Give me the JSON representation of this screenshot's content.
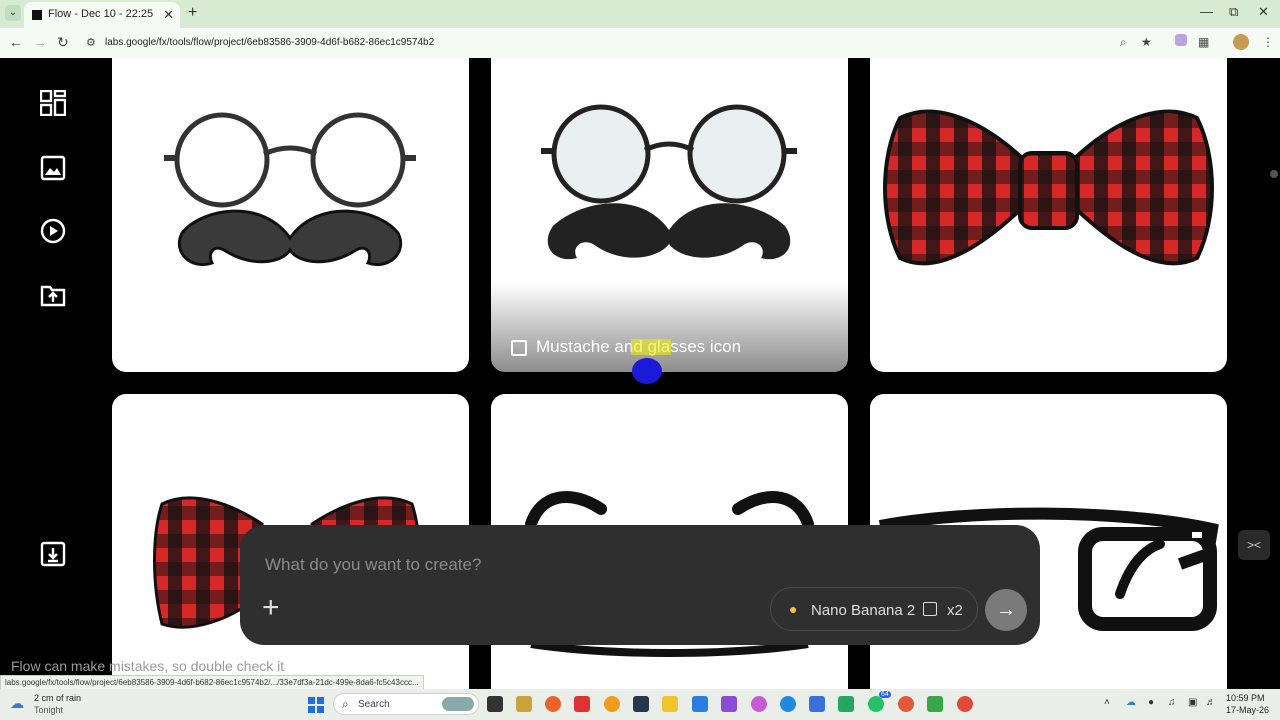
{
  "browser": {
    "tab_title": "Flow - Dec 10 - 22:25",
    "url": "labs.google/fx/tools/flow/project/6eb83586-3909-4d6f-b682-86ec1c9574b2",
    "status_url": "labs.google/fx/tools/flow/project/6eb83586-3909-4d6f-b682-86ec1c9574b2/.../33e7df3a-21dc-499e-8da6-fc5c43ccc..."
  },
  "rail": {
    "items": [
      "grid-view",
      "images",
      "videos",
      "upload-folder"
    ],
    "bottom": "download"
  },
  "tiles": {
    "hover_caption": "Mustache and glasses icon"
  },
  "prompt": {
    "placeholder": "What do you want to create?",
    "model_name": "Nano Banana 2",
    "count": "x2",
    "disclaimer": "Flow can make mistakes, so double check it"
  },
  "taskbar": {
    "weather_line1": "2 cm of rain",
    "weather_line2": "Tonight",
    "search_label": "Search",
    "badge": "64",
    "time": "10:59 PM",
    "date": "17-May-26"
  },
  "colors": {
    "plaid_red": "#d62828",
    "accent_blue": "#1a1ad8"
  }
}
